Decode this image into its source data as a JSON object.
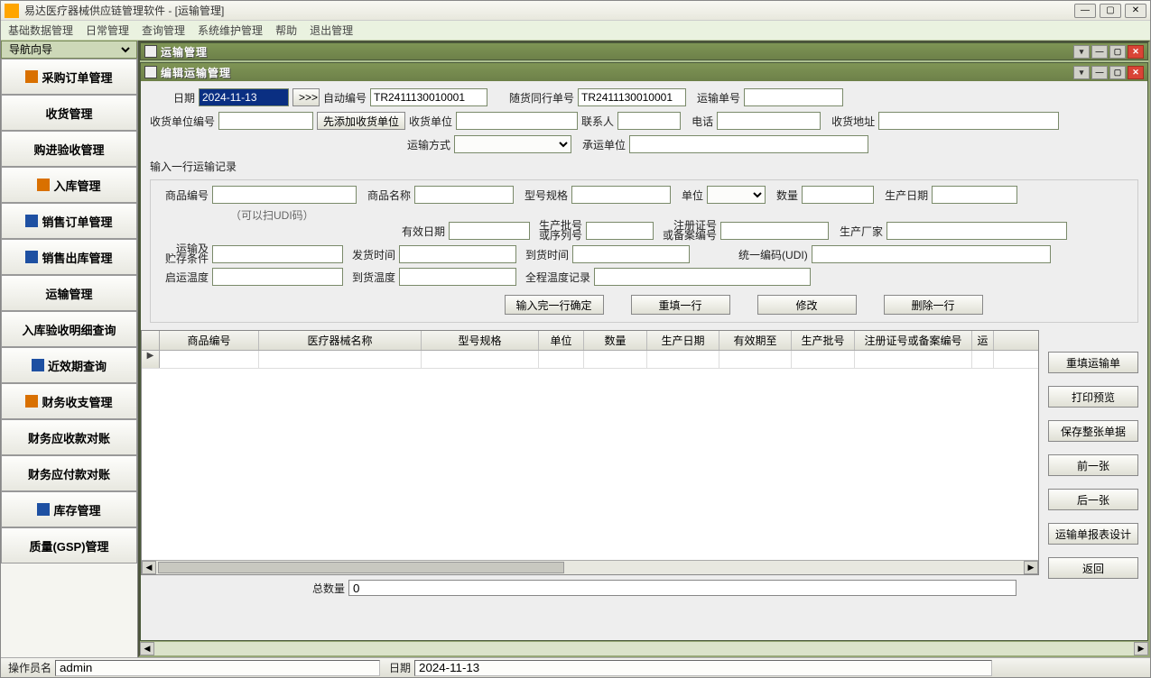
{
  "window": {
    "title": "易达医疗器械供应链管理软件 - [运输管理]"
  },
  "menu": [
    "基础数据管理",
    "日常管理",
    "查询管理",
    "系统维护管理",
    "帮助",
    "退出管理"
  ],
  "nav": {
    "header": "导航向导",
    "items": [
      "采购订单管理",
      "收货管理",
      "购进验收管理",
      "入库管理",
      "销售订单管理",
      "销售出库管理",
      "运输管理",
      "入库验收明细查询",
      "近效期查询",
      "财务收支管理",
      "财务应收款对账",
      "财务应付款对账",
      "库存管理",
      "质量(GSP)管理"
    ]
  },
  "child_back": {
    "title": "运输管理"
  },
  "child": {
    "title": "编辑运输管理"
  },
  "form": {
    "date_label": "日期",
    "date_value": "2024-11-13",
    "more_btn": ">>>",
    "auto_no_label": "自动编号",
    "auto_no_value": "TR2411130010001",
    "accomp_label": "随货同行单号",
    "accomp_value": "TR2411130010001",
    "transport_no_label": "运输单号",
    "recv_unit_no_label": "收货单位编号",
    "add_recv_btn": "先添加收货单位",
    "recv_unit_label": "收货单位",
    "contact_label": "联系人",
    "phone_label": "电话",
    "recv_addr_label": "收货地址",
    "trans_mode_label": "运输方式",
    "carrier_label": "承运单位",
    "record_group": "输入一行运输记录",
    "prod_no_label": "商品编号",
    "udi_hint": "（可以扫UDI码）",
    "prod_name_label": "商品名称",
    "spec_label": "型号规格",
    "unit_label": "单位",
    "qty_label": "数量",
    "prod_date_label": "生产日期",
    "expire_label": "有效日期",
    "batch_label": "生产批号\n或序列号",
    "reg_label": "注册证号\n或备案编号",
    "maker_label": "生产厂家",
    "store_label": "运输及\n贮存条件",
    "ship_time_label": "发货时间",
    "arrive_time_label": "到货时间",
    "udi_code_label": "统一编码(UDI)",
    "start_temp_label": "启运温度",
    "arrive_temp_label": "到货温度",
    "temp_log_label": "全程温度记录",
    "btn_confirm": "输入完一行确定",
    "btn_refill": "重填一行",
    "btn_edit": "修改",
    "btn_delete": "删除一行"
  },
  "grid_headers": [
    "商品编号",
    "医疗器械名称",
    "型号规格",
    "单位",
    "数量",
    "生产日期",
    "有效期至",
    "生产批号",
    "注册证号或备案编号",
    "运"
  ],
  "side_buttons": [
    "重填运输单",
    "打印预览",
    "保存整张单据",
    "前一张",
    "后一张",
    "运输单报表设计",
    "返回"
  ],
  "totals": {
    "label": "总数量",
    "value": "0"
  },
  "status": {
    "op_label": "操作员名",
    "op_value": "admin",
    "date_label": "日期",
    "date_value": "2024-11-13"
  }
}
